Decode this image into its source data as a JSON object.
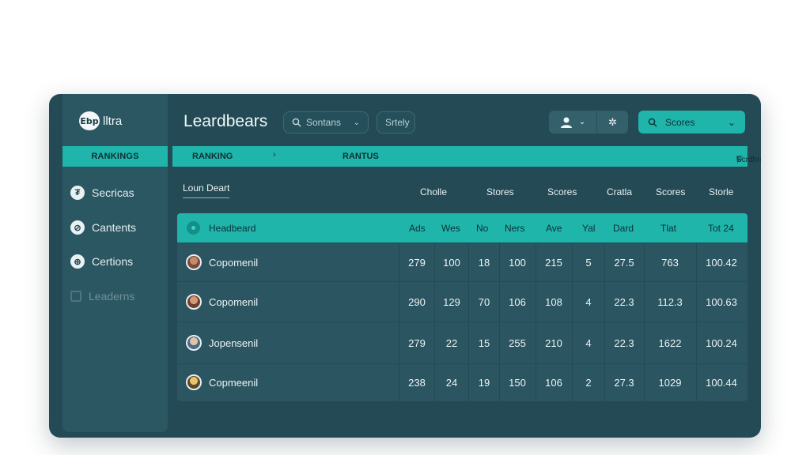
{
  "brand": {
    "badge": "Ebp",
    "name": "lltra"
  },
  "sidebar": {
    "header": "RANKINGS",
    "items": [
      {
        "icon": "dollar-icon",
        "glyph": "₮",
        "label": "Secricas"
      },
      {
        "icon": "link-icon",
        "glyph": "⊘",
        "label": "Cantents"
      },
      {
        "icon": "shield-icon",
        "glyph": "⊕",
        "label": "Certions"
      },
      {
        "icon": "grid-icon",
        "glyph": "",
        "label": "Leaderns"
      }
    ]
  },
  "header": {
    "title": "Leardbears",
    "search_label": "Sontans",
    "filter_label": "Srtely",
    "scores_label": "Scores"
  },
  "tab_bar": {
    "left": "RANKING",
    "sep": "›",
    "middle": "RANTUS",
    "right_label": "Scrdhrs",
    "plus": "+"
  },
  "section": {
    "subtitle": "Loun Deart",
    "columns": [
      "Cholle",
      "Stores",
      "Scores",
      "Cratla",
      "Scores",
      "Storle"
    ]
  },
  "table": {
    "header": [
      "Headbeard",
      "Ads",
      "Wes",
      "No",
      "Ners",
      "Ave",
      "Yal",
      "Dard",
      "Tlat",
      "Tot 24"
    ],
    "rows": [
      {
        "name": "Copomenil",
        "values": [
          "279",
          "100",
          "18",
          "100",
          "215",
          "5",
          "27.5",
          "763",
          "100.42"
        ]
      },
      {
        "name": "Copomenil",
        "values": [
          "290",
          "129",
          "70",
          "106",
          "108",
          "4",
          "22.3",
          "112.3",
          "100.63"
        ]
      },
      {
        "name": "Jopensenil",
        "values": [
          "279",
          "22",
          "15",
          "255",
          "210",
          "4",
          "22.3",
          "1622",
          "100.24"
        ]
      },
      {
        "name": "Copmeenil",
        "values": [
          "238",
          "24",
          "19",
          "150",
          "106",
          "2",
          "27.3",
          "1029",
          "100.44"
        ]
      }
    ]
  },
  "colors": {
    "accent": "#1fb5ab",
    "window": "#234a55",
    "sidebar": "#2b5762"
  }
}
